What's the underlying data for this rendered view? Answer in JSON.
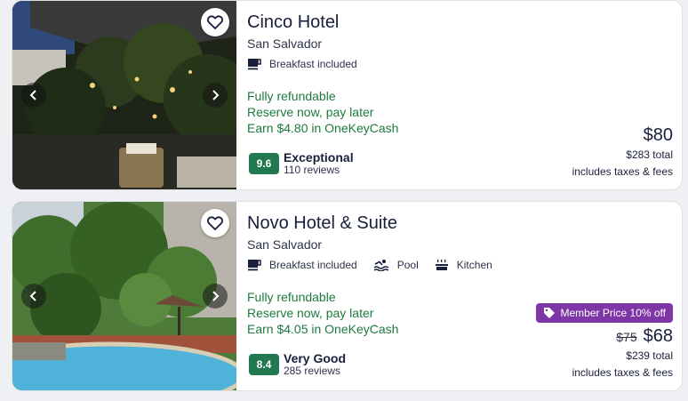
{
  "listings": [
    {
      "name": "Cinco Hotel",
      "city": "San Salvador",
      "amenities": [
        {
          "label": "Breakfast included",
          "icon": "coffee-icon"
        }
      ],
      "perks": [
        "Fully refundable",
        "Reserve now, pay later",
        "Earn $4.80 in OneKeyCash"
      ],
      "rating": {
        "score": "9.6",
        "word": "Exceptional",
        "reviews": "110 reviews"
      },
      "price": {
        "current": "$80",
        "total": "$283 total",
        "taxes": "includes taxes & fees"
      }
    },
    {
      "name": "Novo Hotel & Suite",
      "city": "San Salvador",
      "amenities": [
        {
          "label": "Breakfast included",
          "icon": "coffee-icon"
        },
        {
          "label": "Pool",
          "icon": "pool-icon"
        },
        {
          "label": "Kitchen",
          "icon": "kitchen-icon"
        }
      ],
      "perks": [
        "Fully refundable",
        "Reserve now, pay later",
        "Earn $4.05 in OneKeyCash"
      ],
      "rating": {
        "score": "8.4",
        "word": "Very Good",
        "reviews": "285 reviews"
      },
      "badge": "Member Price 10% off",
      "price": {
        "old": "$75",
        "current": "$68",
        "total": "$239 total",
        "taxes": "includes taxes & fees"
      }
    }
  ],
  "colors": {
    "perk_green": "#1e7a3e",
    "score_green": "#227950",
    "member_purple": "#7e35a5",
    "text": "#191e3b"
  }
}
